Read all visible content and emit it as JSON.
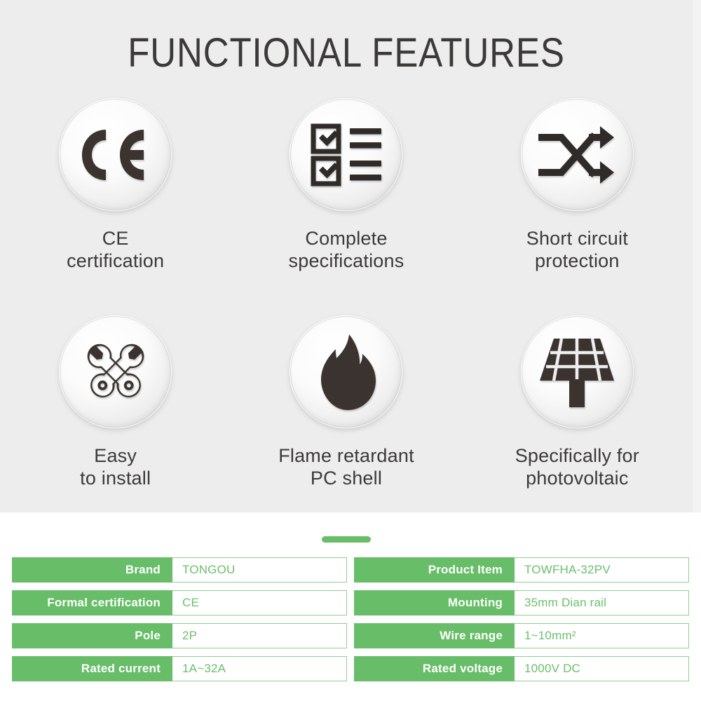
{
  "header": {
    "title": "FUNCTIONAL FEATURES"
  },
  "colors": {
    "background_gray": "#eeedee",
    "text_dark": "#3b3a38",
    "green_accent": "#68bd69",
    "green_border": "#8fcf8f",
    "green_text": "#6bbf6b"
  },
  "features": [
    {
      "icon": "ce-mark-icon",
      "line1": "CE",
      "line2": "certification"
    },
    {
      "icon": "checklist-icon",
      "line1": "Complete",
      "line2": "specifications"
    },
    {
      "icon": "shuffle-arrows-icon",
      "line1": "Short circuit",
      "line2": "protection"
    },
    {
      "icon": "crossed-wrenches-icon",
      "line1": "Easy",
      "line2": "to install"
    },
    {
      "icon": "flame-icon",
      "line1": "Flame retardant",
      "line2": "PC shell"
    },
    {
      "icon": "solar-panel-icon",
      "line1": "Specifically for",
      "line2": "photovoltaic"
    }
  ],
  "divider": {
    "shape": "rounded-bar"
  },
  "specs": {
    "left": [
      {
        "key": "Brand",
        "value": "TONGOU"
      },
      {
        "key": "Formal certification",
        "value": "CE"
      },
      {
        "key": "Pole",
        "value": "2P"
      },
      {
        "key": "Rated current",
        "value": "1A~32A"
      }
    ],
    "right": [
      {
        "key": "Product Item",
        "value": "TOWFHA-32PV"
      },
      {
        "key": "Mounting",
        "value": "35mm Dian rail"
      },
      {
        "key": "Wire range",
        "value": "1~10mm²"
      },
      {
        "key": "Rated voltage",
        "value": "1000V DC"
      }
    ]
  }
}
